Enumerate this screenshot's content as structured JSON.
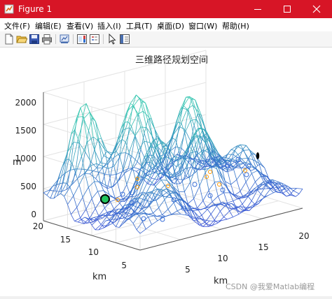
{
  "window": {
    "title": "Figure 1",
    "titlebar_color": "#d71526",
    "controls": [
      "minimize-icon",
      "maximize-icon",
      "close-icon"
    ]
  },
  "menu": {
    "items": [
      "文件(F)",
      "编辑(E)",
      "查看(V)",
      "插入(I)",
      "工具(T)",
      "桌面(D)",
      "窗口(W)",
      "帮助(H)"
    ]
  },
  "toolbar": {
    "icons": [
      "new-figure-icon",
      "open-file-icon",
      "save-icon",
      "print-icon",
      "link-plot-icon",
      "insert-colorbar-icon",
      "insert-legend-icon",
      "edit-plot-arrow-icon",
      "property-inspector-icon"
    ]
  },
  "plot": {
    "title": "三维路径规划空间",
    "z_label": "m",
    "y_label": "km",
    "x_label": "km",
    "z_ticks": [
      "0",
      "500",
      "1000",
      "1500",
      "2000"
    ],
    "y_ticks": [
      "20",
      "15",
      "10",
      "5"
    ],
    "x_ticks": [
      "5",
      "10",
      "15",
      "20"
    ],
    "colors": {
      "mesh_low": "#3a4dd8",
      "mesh_high": "#35c7b0",
      "start_marker": "#22c55e",
      "waypoint": "#ff9900",
      "path_nodes": "#3b6fd8"
    }
  },
  "watermark": "CSDN @我爱Matlab编程"
}
